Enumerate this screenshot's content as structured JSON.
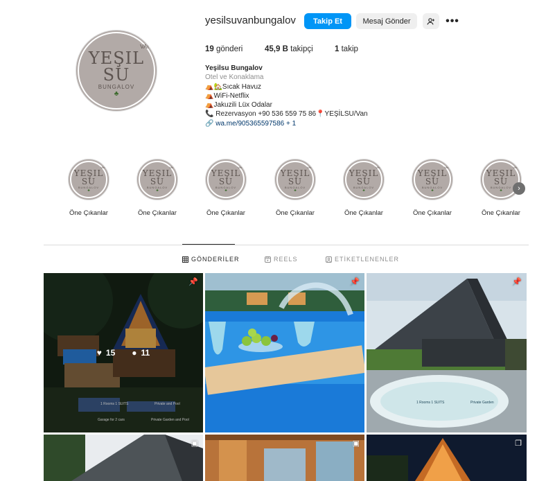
{
  "profile": {
    "logo": {
      "top": "VAN",
      "main": "YEŞIL SU",
      "sub": "BUNGALOV"
    },
    "username": "yesilsuvanbungalov",
    "buttons": {
      "follow": "Takip Et",
      "message": "Mesaj Gönder",
      "add_user_icon": "add-user-icon",
      "more_icon": "more-icon"
    },
    "stats": {
      "posts_count": "19",
      "posts_label": "gönderi",
      "followers_count": "45,9 B",
      "followers_label": "takipçi",
      "following_count": "1",
      "following_label": "takip"
    },
    "bio": {
      "name": "Yeşilsu Bungalov",
      "category": "Otel ve Konaklama",
      "line1": "Sıcak Havuz",
      "line2": "WiFi-Netflix",
      "line3": "Jakuzili Lüx Odalar",
      "line4": "Rezervasyon +90 536 559 75 86",
      "line4b": "YEŞİLSU/Van",
      "link": "wa.me/905365597586 + 1"
    }
  },
  "highlights": [
    {
      "label": "Öne Çıkanlar"
    },
    {
      "label": "Öne Çıkanlar"
    },
    {
      "label": "Öne Çıkanlar"
    },
    {
      "label": "Öne Çıkanlar"
    },
    {
      "label": "Öne Çıkanlar"
    },
    {
      "label": "Öne Çıkanlar"
    },
    {
      "label": "Öne Çıkanlar"
    }
  ],
  "tabs": [
    {
      "label": "GÖNDERİLER",
      "active": true
    },
    {
      "label": "REELS",
      "active": false
    },
    {
      "label": "ETİKETLENENLER",
      "active": false
    }
  ],
  "posts": [
    {
      "likes": "15",
      "comments": "11",
      "badge": "pin-icon"
    },
    {
      "badge": "pin-icon"
    },
    {
      "badge": "pin-icon"
    },
    {
      "badge": "reel-icon"
    },
    {
      "badge": "reel-icon"
    },
    {
      "badge": "carousel-icon"
    }
  ],
  "colors": {
    "accent": "#0095f6",
    "border": "#dbdbdb",
    "logo_bg": "#b2aaa7"
  }
}
